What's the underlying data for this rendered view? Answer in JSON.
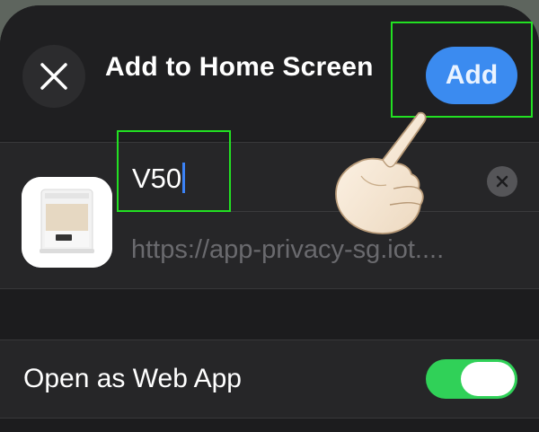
{
  "header": {
    "title": "Add to Home Screen",
    "add_label": "Add",
    "close_icon": "close-icon"
  },
  "app_entry": {
    "icon": "robot-vacuum-app-icon",
    "name_value": "V50",
    "url": "https://app-privacy-sg.iot...."
  },
  "options": {
    "web_app_label": "Open as Web App",
    "web_app_enabled": true
  },
  "colors": {
    "accent": "#3b8bf0",
    "toggle_on": "#30d158",
    "highlight": "#22e022"
  }
}
